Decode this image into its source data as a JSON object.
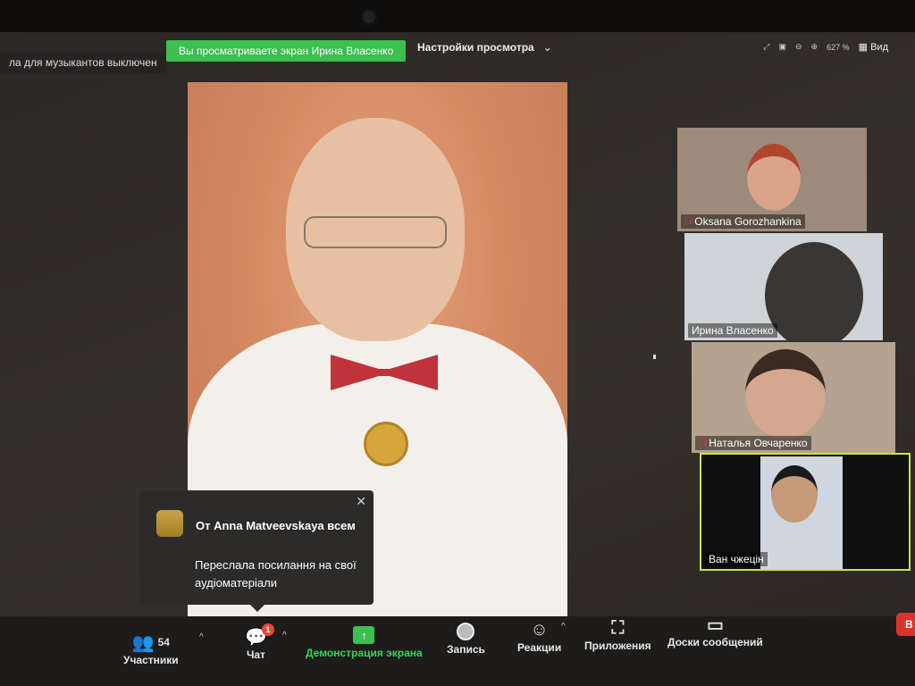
{
  "top": {
    "muted_note": "ла для музыкантов выключен",
    "viewing_banner": "Вы просматриваете экран Ирина Власенко",
    "view_settings": "Настройки просмотра",
    "zoom_level": "627 %",
    "view_label": "Вид"
  },
  "participants": [
    {
      "name": "Oksana Gorozhankina",
      "muted": true
    },
    {
      "name": "Ирина Власенко",
      "muted": false
    },
    {
      "name": "Наталья Овчаренко",
      "muted": true
    },
    {
      "name": "Ван чжецін",
      "muted": false,
      "active": true
    }
  ],
  "chat_notification": {
    "from": "От Anna Matveevskaya всем",
    "message": "Переслала посилання на свої аудіоматеріали"
  },
  "toolbar": {
    "participants_label": "Участники",
    "participants_count": "54",
    "chat_label": "Чат",
    "chat_badge": "1",
    "share_label": "Демонстрация экрана",
    "record_label": "Запись",
    "reactions_label": "Реакции",
    "apps_label": "Приложения",
    "whiteboards_label": "Доски сообщений",
    "end_label": "В"
  },
  "colors": {
    "accent_green": "#3bbf4f",
    "badge_red": "#e34a3c"
  }
}
